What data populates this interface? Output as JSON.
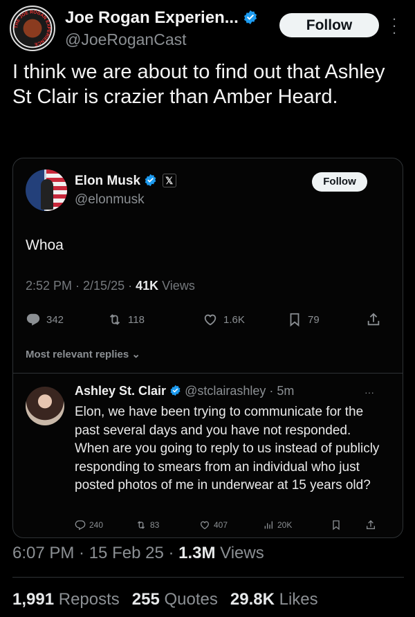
{
  "author": {
    "display_name": "Joe Rogan Experien...",
    "handle": "@JoeRoganCast",
    "avatar_text": "THE JOE ROGAN EXPERIENCE",
    "follow_label": "Follow"
  },
  "tweet": {
    "text": "I think we are about to find out that Ashley St Clair is crazier than Amber Heard."
  },
  "quote": {
    "display_name": "Elon Musk",
    "handle": "@elonmusk",
    "follow_label": "Follow",
    "x_badge": "𝕏",
    "body": "Whoa",
    "time": "2:52 PM · 2/15/25 · ",
    "views_count": "41K",
    "views_label": " Views",
    "actions": {
      "replies": "342",
      "reposts": "118",
      "likes": "1.6K",
      "bookmarks": "79"
    },
    "most_relevant_label": "Most relevant replies",
    "reply": {
      "display_name": "Ashley St. Clair",
      "handle_time": "@stclairashley · 5m",
      "more": "···",
      "text": "Elon, we have been trying to communicate for the past several days and you have not responded. When are you going to reply to us instead of publicly responding to smears from an individual who just posted photos of me in underwear at 15 years old?",
      "actions": {
        "replies": "240",
        "reposts": "83",
        "likes": "407",
        "views": "20K"
      }
    }
  },
  "footer": {
    "time": "6:07 PM · 15 Feb 25 · ",
    "views_count": "1.3M",
    "views_label": " Views",
    "reposts_count": "1,991",
    "reposts_label": "Reposts",
    "quotes_count": "255",
    "quotes_label": "Quotes",
    "likes_count": "29.8K",
    "likes_label": "Likes"
  },
  "colors": {
    "verified": "#1d9bf0",
    "background": "#000000",
    "muted": "#8b8f93"
  }
}
